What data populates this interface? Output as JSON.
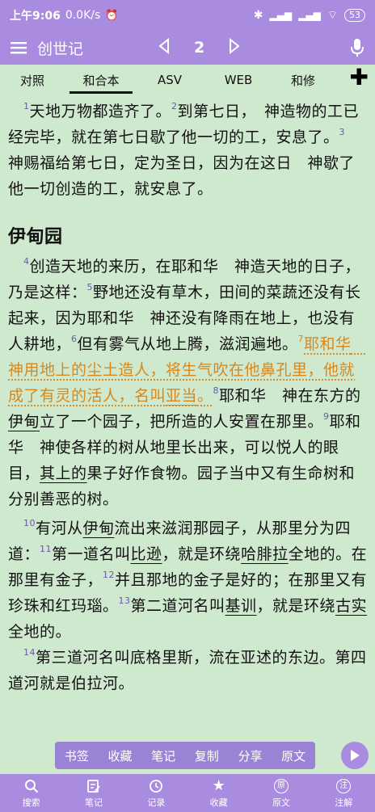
{
  "status": {
    "time": "上午9:06",
    "speed": "0.0K/s",
    "battery": "53"
  },
  "appbar": {
    "title": "创世记",
    "chapter": "2"
  },
  "tabs": [
    "对照",
    "和合本",
    "ASV",
    "WEB",
    "和修"
  ],
  "plus": "✚",
  "verses": {
    "v1": "1",
    "v2": "2",
    "v3": "3",
    "v4": "4",
    "v5": "5",
    "v6": "6",
    "v7": "7",
    "v8": "8",
    "v9": "9",
    "v10": "10",
    "v11": "11",
    "v12": "12",
    "v13": "13",
    "v14": "14",
    "p1a": "天地万物都造齐了。",
    "p1b": "到第七日，　神造物的工已经完毕，就在第七日歇了他一切的工，安息了。",
    "p1c": "　神赐福给第七日，定为圣日，因为在这日　神歇了他一切创造的工，就安息了。",
    "heading": "伊甸园",
    "t4": "创造天地的来历，在耶和华　神造天地的日子，乃是这样：",
    "t5": "野地还没有草木，田间的菜蔬还没有长起来，因为耶和华　神还没有降雨在地上，也没有人耕地，",
    "t6": "但有雾气从地上腾，滋润遍地。",
    "t7a": "耶和华　神用地上的尘土造人，将生气吹在他鼻孔里，他就成了有灵的活人，名叫",
    "t7b": "亚当",
    "t7c": "。",
    "t8a": "耶和华　神在东方的",
    "t8b": "伊甸",
    "t8c": "立了一个园子，把所造的人安置在那里。",
    "t9a": "耶和华　神使各样的树从地里长出来，可以悦人的眼目，",
    "t9b": "其上的",
    "t9c": "果子好作食物。园子当中又有生命树和分别善恶的树。",
    "t10a": "有河从",
    "t10b": "伊甸",
    "t10c": "流出来滋润那园子，从那里分为四道：",
    "t11a": "第一道名叫",
    "t11b": "比逊",
    "t11c": "，就是环绕",
    "t11d": "哈腓拉",
    "t11e": "全地的。在那里有金子，",
    "t12": "并且那地的金子是好的；在那里又有珍珠和红玛瑙。",
    "t13a": "第二道河名叫",
    "t13b": "基训",
    "t13c": "，就是环绕",
    "t13d": "古实",
    "t13e": "全地的。",
    "t14": "第三道河名叫底格里斯，流在亚述的东边。第四道河就是伯拉河。"
  },
  "toolbar": [
    "书签",
    "收藏",
    "笔记",
    "复制",
    "分享",
    "原文"
  ],
  "bottom": [
    {
      "label": "搜索",
      "icon": "search-icon"
    },
    {
      "label": "笔记",
      "icon": "note-icon"
    },
    {
      "label": "记录",
      "icon": "history-icon"
    },
    {
      "label": "收藏",
      "icon": "star-icon"
    },
    {
      "label": "原文",
      "icon": "original-icon",
      "glyph": "原"
    },
    {
      "label": "注解",
      "icon": "annotation-icon",
      "glyph": "注"
    }
  ]
}
